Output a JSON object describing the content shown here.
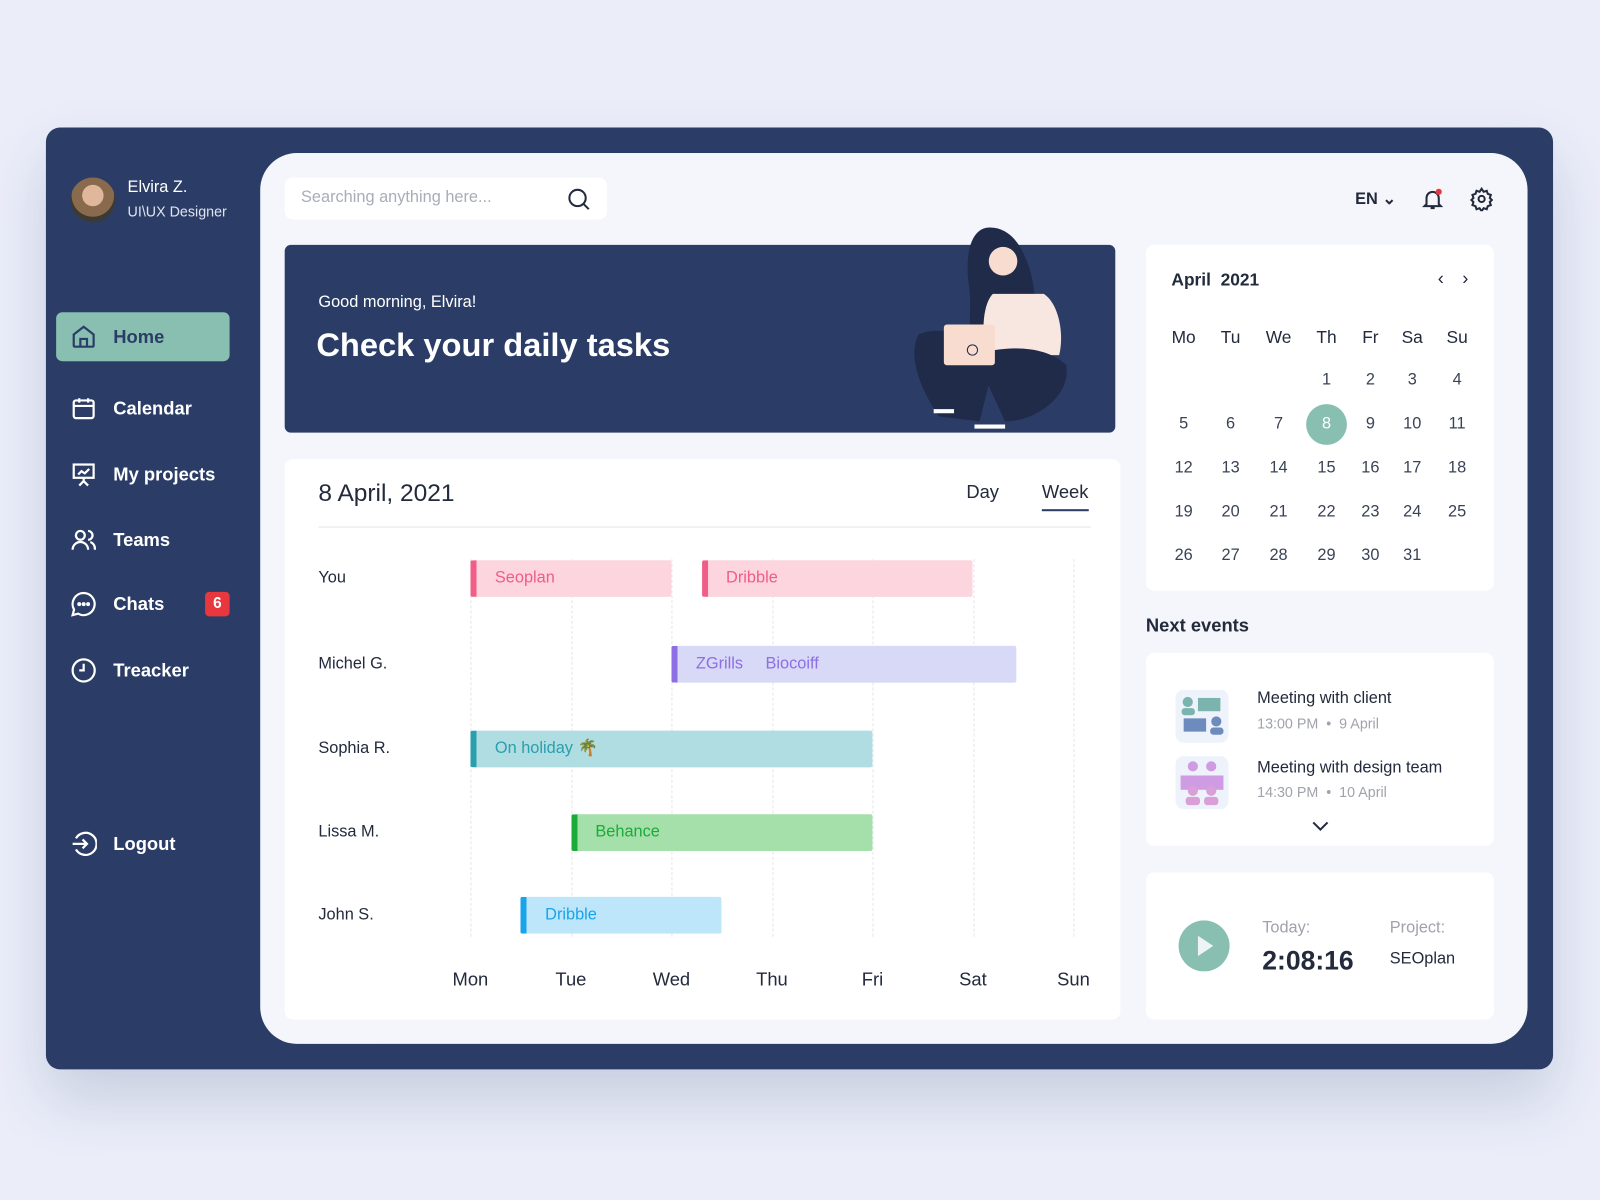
{
  "user": {
    "name": "Elvira Z.",
    "role": "UI\\UX Designer"
  },
  "sidebar": {
    "items": [
      {
        "label": "Home",
        "icon": "home-icon",
        "active": true
      },
      {
        "label": "Calendar",
        "icon": "calendar-icon"
      },
      {
        "label": "My projects",
        "icon": "presentation-icon"
      },
      {
        "label": "Teams",
        "icon": "users-icon"
      },
      {
        "label": "Chats",
        "icon": "chat-icon",
        "badge": "6"
      },
      {
        "label": "Treacker",
        "icon": "clock-icon"
      }
    ],
    "logout": "Logout"
  },
  "header": {
    "search_placeholder": "Searching anything here...",
    "language": "EN"
  },
  "hero": {
    "greeting": "Good morning, Elvira!",
    "title": "Check your daily tasks"
  },
  "schedule": {
    "date": "8 April, 2021",
    "tabs": [
      "Day",
      "Week"
    ],
    "active_tab": "Week",
    "days": [
      "Mon",
      "Tue",
      "Wed",
      "Thu",
      "Fri",
      "Sat",
      "Sun"
    ],
    "rows": [
      {
        "name": "You",
        "tasks": [
          {
            "label": "Seoplan",
            "start": 0,
            "end": 2,
            "color": "#f05d86",
            "bg": "#fcd5df"
          },
          {
            "label": "Dribble",
            "start": 2.3,
            "end": 5,
            "color": "#f05d86",
            "bg": "#fcd5df"
          }
        ]
      },
      {
        "name": "Michel G.",
        "tasks": [
          {
            "label": "ZGrills",
            "label2": "Biocoiff",
            "start": 2,
            "end": 5.43,
            "color": "#8e6ee5",
            "bg": "#d8d8f7"
          }
        ]
      },
      {
        "name": "Sophia R.",
        "tasks": [
          {
            "label": "On holiday 🌴",
            "start": 0,
            "end": 4,
            "color": "#2a9fae",
            "bg": "#b0dde2"
          }
        ]
      },
      {
        "name": "Lissa M.",
        "tasks": [
          {
            "label": "Behance",
            "start": 1,
            "end": 4,
            "color": "#1cab39",
            "bg": "#a5e0ab"
          }
        ]
      },
      {
        "name": "John S.",
        "tasks": [
          {
            "label": "Dribble",
            "start": 0.5,
            "end": 2.5,
            "color": "#1aa3ea",
            "bg": "#bde6fa"
          }
        ]
      }
    ]
  },
  "calendar": {
    "month": "April",
    "year": "2021",
    "weekdays": [
      "Mo",
      "Tu",
      "We",
      "Th",
      "Fr",
      "Sa",
      "Su"
    ],
    "first_weekday": 3,
    "days_in_month": 31,
    "selected": 8,
    "accent": "#88bfb1"
  },
  "events": {
    "title": "Next events",
    "items": [
      {
        "title": "Meeting with client",
        "time": "13:00 PM",
        "date": "9 April"
      },
      {
        "title": "Meeting with design team",
        "time": "14:30 PM",
        "date": "10 April"
      }
    ]
  },
  "tracker": {
    "today_label": "Today:",
    "time": "2:08:16",
    "project_label": "Project:",
    "project": "SEOplan"
  }
}
